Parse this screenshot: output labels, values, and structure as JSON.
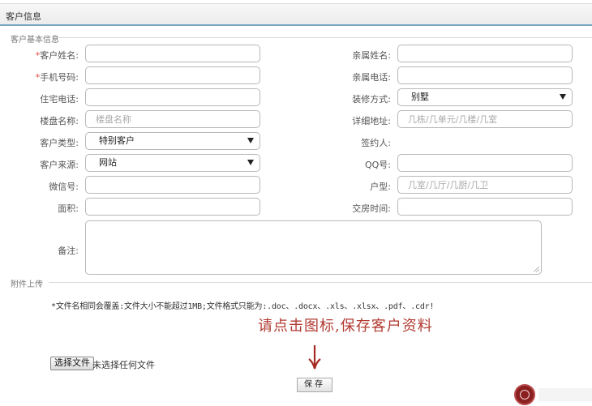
{
  "header": {
    "title": "客户信息"
  },
  "sections": {
    "basic": "客户基本信息",
    "attachment": "附件上传"
  },
  "form": {
    "name_label": "客户姓名:",
    "relative_name_label": "亲属姓名:",
    "mobile_label": "手机号码:",
    "relative_phone_label": "亲属电话:",
    "home_phone_label": "住宅电话:",
    "decoration_label": "装修方式:",
    "decoration_value": "别墅",
    "building_label": "楼盘名称:",
    "building_placeholder": "楼盘名称",
    "address_label": "详细地址:",
    "address_placeholder": "几栋/几单元/几楼/几室",
    "type_label": "客户类型:",
    "type_value": "特别客户",
    "signer_label": "签约人:",
    "source_label": "客户来源:",
    "source_value": "网站",
    "qq_label": "QQ号:",
    "wechat_label": "微信号:",
    "layout_label": "户型:",
    "layout_placeholder": "几室/几厅/几厨/几卫",
    "area_label": "面积:",
    "delivery_label": "交房时间:",
    "remark_label": "备注:",
    "required_mark": "*"
  },
  "attachment": {
    "note": "*文件名相同会覆盖:文件大小不能超过1MB;文件格式只能为:.doc、.docx、.xls、.xlsx、.pdf、.cdr!",
    "hint": "请点击图标,保存客户资料",
    "choose_file": "选择文件",
    "no_file": "未选择任何文件"
  },
  "save_button": "保存",
  "colors": {
    "accent_line": "#7aa6c2",
    "required": "#e0463f",
    "hint": "#b23a32"
  },
  "icons": {
    "arrow": "arrow-down-icon",
    "seal": "seal-logo-icon"
  }
}
